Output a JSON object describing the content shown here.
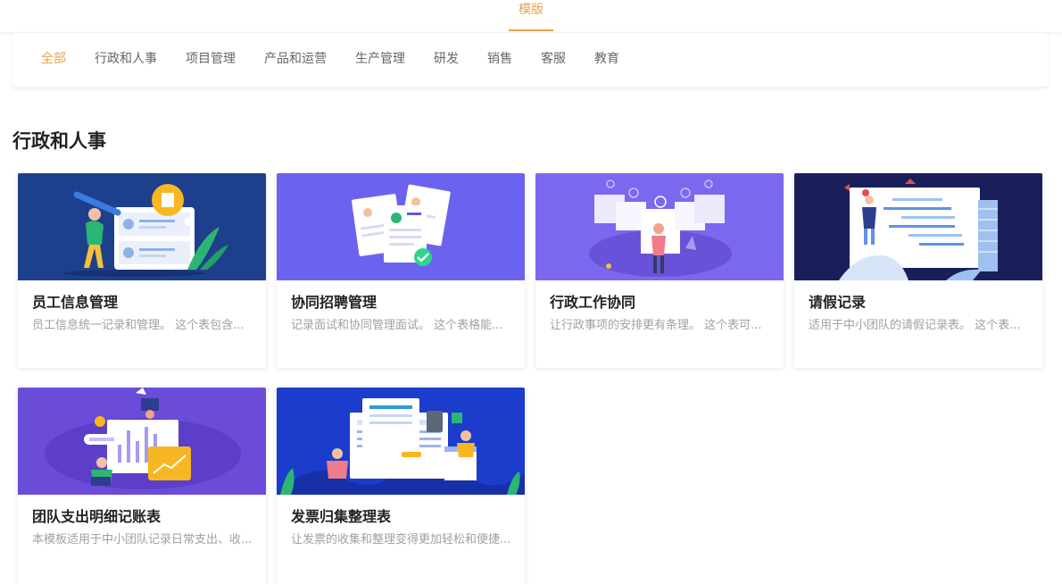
{
  "header": {
    "tab": "模版"
  },
  "filters": [
    "全部",
    "行政和人事",
    "项目管理",
    "产品和运营",
    "生产管理",
    "研发",
    "销售",
    "客服",
    "教育"
  ],
  "section": {
    "title": "行政和人事"
  },
  "cards": [
    {
      "title": "员工信息管理",
      "desc": "员工信息统一记录和管理。 这个表包含..."
    },
    {
      "title": "协同招聘管理",
      "desc": "记录面试和协同管理面试。 这个表格能..."
    },
    {
      "title": "行政工作协同",
      "desc": "让行政事项的安排更有条理。 这个表可..."
    },
    {
      "title": "请假记录",
      "desc": "适用于中小团队的请假记录表。 这个表..."
    },
    {
      "title": "团队支出明细记账表",
      "desc": "本模板适用于中小团队记录日常支出、收..."
    },
    {
      "title": "发票归集整理表",
      "desc": "让发票的收集和整理变得更加轻松和便捷..."
    }
  ],
  "colors": {
    "accent": "#e8a24a"
  }
}
